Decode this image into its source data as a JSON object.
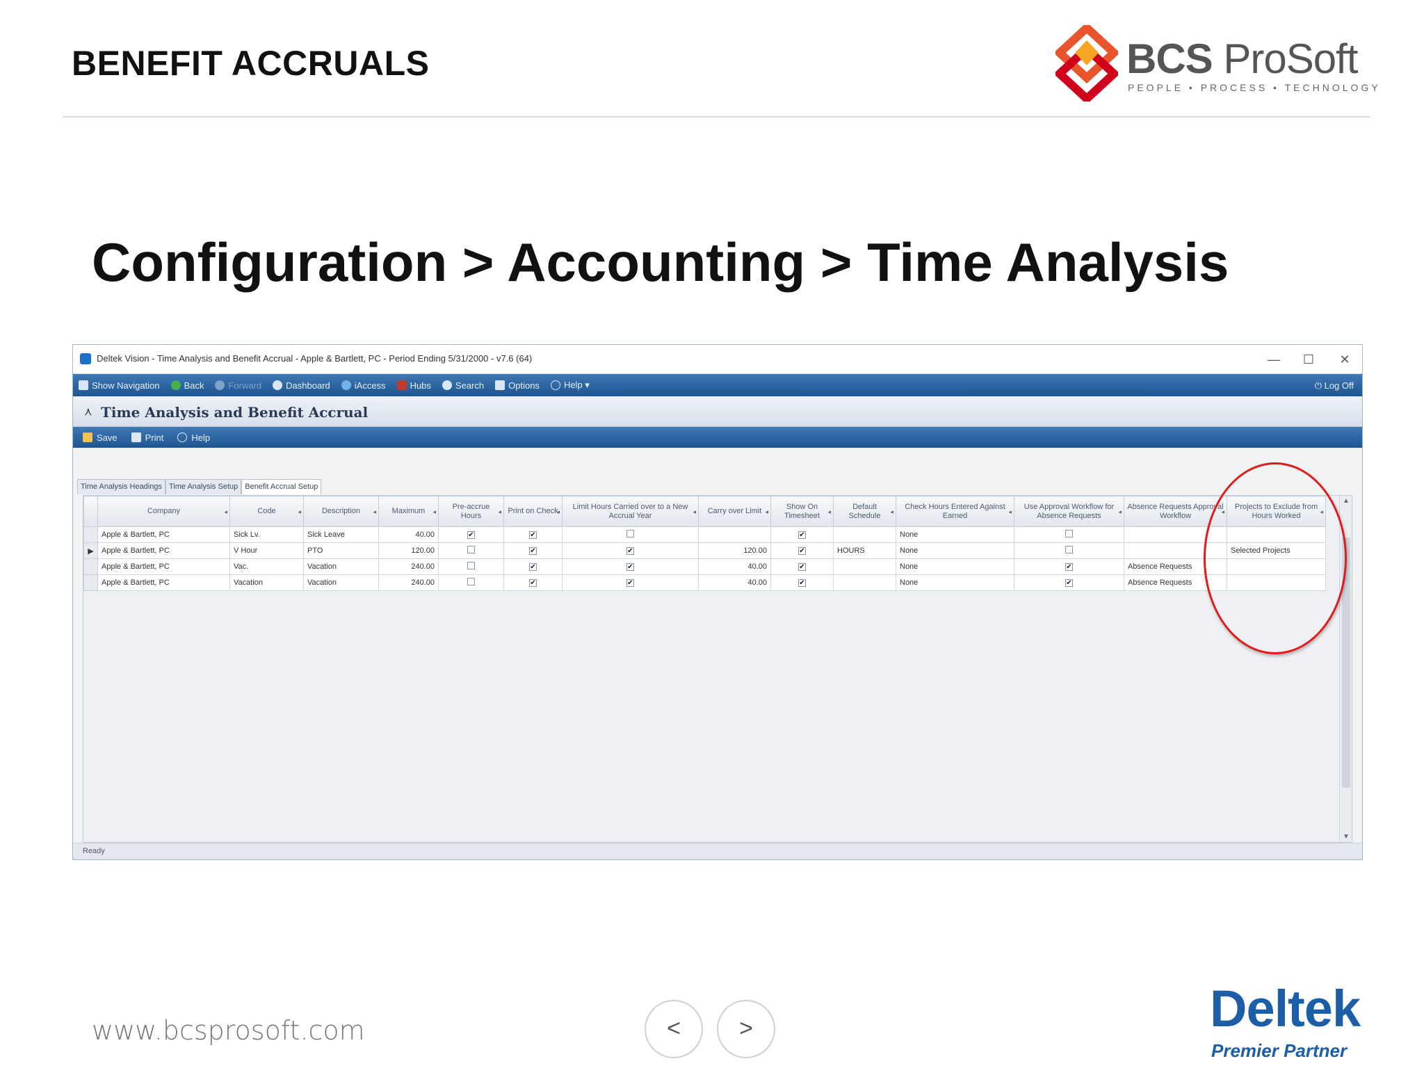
{
  "slide": {
    "title": "BENEFIT ACCRUALS",
    "breadcrumb": "Configuration > Accounting > Time Analysis",
    "footer_url": "www.bcsprosoft.com",
    "prev_glyph": "<",
    "next_glyph": ">"
  },
  "logo": {
    "bold": "BCS",
    "name": "ProSoft",
    "tagline": "PEOPLE • PROCESS • TECHNOLOGY",
    "mark_colors": [
      "#e8542b",
      "#f5a623",
      "#d0021b"
    ]
  },
  "partner": {
    "name": "Deltek",
    "tagline": "Premier Partner",
    "color": "#1c5ea8"
  },
  "app": {
    "window_title": "Deltek Vision - Time Analysis and Benefit Accrual - Apple & Bartlett, PC - Period Ending 5/31/2000 - v7.6 (64)",
    "window_controls": {
      "minimize": "—",
      "maximize": "☐",
      "close": "✕"
    },
    "navbar": [
      {
        "label": "Show Navigation",
        "icon": "navigation-icon"
      },
      {
        "label": "Back",
        "icon": "back-arrow-icon"
      },
      {
        "label": "Forward",
        "icon": "forward-arrow-icon",
        "disabled": true
      },
      {
        "label": "Dashboard",
        "icon": "dashboard-icon"
      },
      {
        "label": "iAccess",
        "icon": "iaccess-icon"
      },
      {
        "label": "Hubs",
        "icon": "hubs-icon"
      },
      {
        "label": "Search",
        "icon": "search-icon"
      },
      {
        "label": "Options",
        "icon": "options-icon"
      },
      {
        "label": "Help ▾",
        "icon": "help-icon"
      }
    ],
    "logoff": "Log Off",
    "page_title": "Time Analysis and Benefit Accrual",
    "toolbar": {
      "save": "Save",
      "print": "Print",
      "help": "Help"
    },
    "tabs": [
      "Time Analysis Headings",
      "Time Analysis Setup",
      "Benefit Accrual Setup"
    ],
    "active_tab": 2,
    "grid": {
      "columns": [
        "Company",
        "Code",
        "Description",
        "Maximum",
        "Pre-accrue Hours",
        "Print on Check",
        "Limit Hours Carried over to a New Accrual Year",
        "Carry over Limit",
        "Show On Timesheet",
        "Default Schedule",
        "Check Hours Entered Against Earned",
        "Use Approval Workflow for Absence Requests",
        "Absence Requests Approval Workflow",
        "Projects to Exclude from Hours Worked"
      ],
      "rows": [
        {
          "selector": "",
          "company": "Apple & Bartlett, PC",
          "code": "Sick Lv.",
          "description": "Sick Leave",
          "maximum": "40.00",
          "preaccrue": true,
          "print_check": true,
          "limit_carry": false,
          "carry_limit": "",
          "show_ts": true,
          "schedule": "",
          "check_hours": "None",
          "use_approval": false,
          "approval_wf": "",
          "projects_exclude": ""
        },
        {
          "selector": "▶",
          "company": "Apple & Bartlett, PC",
          "code": "V Hour",
          "description": "PTO",
          "maximum": "120.00",
          "preaccrue": false,
          "print_check": true,
          "limit_carry": true,
          "carry_limit": "120.00",
          "show_ts": true,
          "schedule": "HOURS",
          "check_hours": "None",
          "use_approval": false,
          "approval_wf": "",
          "projects_exclude": "Selected Projects"
        },
        {
          "selector": "",
          "company": "Apple & Bartlett, PC",
          "code": "Vac.",
          "description": "Vacation",
          "maximum": "240.00",
          "preaccrue": false,
          "print_check": true,
          "limit_carry": true,
          "carry_limit": "40.00",
          "show_ts": true,
          "schedule": "",
          "check_hours": "None",
          "use_approval": true,
          "approval_wf": "Absence Requests",
          "projects_exclude": ""
        },
        {
          "selector": "",
          "company": "Apple & Bartlett, PC",
          "code": "Vacation",
          "description": "Vacation",
          "maximum": "240.00",
          "preaccrue": false,
          "print_check": true,
          "limit_carry": true,
          "carry_limit": "40.00",
          "show_ts": true,
          "schedule": "",
          "check_hours": "None",
          "use_approval": true,
          "approval_wf": "Absence Requests",
          "projects_exclude": ""
        }
      ]
    },
    "status": "Ready",
    "highlight_color": "#e01b1b"
  }
}
